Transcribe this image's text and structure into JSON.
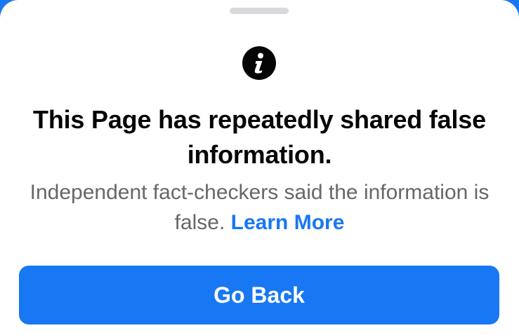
{
  "dialog": {
    "icon": "info-icon",
    "title": "This Page has repeatedly shared false information.",
    "body": "Independent fact-checkers said the information is false.",
    "link_label": "Learn More",
    "button_label": "Go Back"
  },
  "colors": {
    "accent": "#1877f2",
    "title_text": "#050505",
    "body_text": "#65676b",
    "grabber": "#d7d9dc",
    "background": "#ffffff"
  }
}
